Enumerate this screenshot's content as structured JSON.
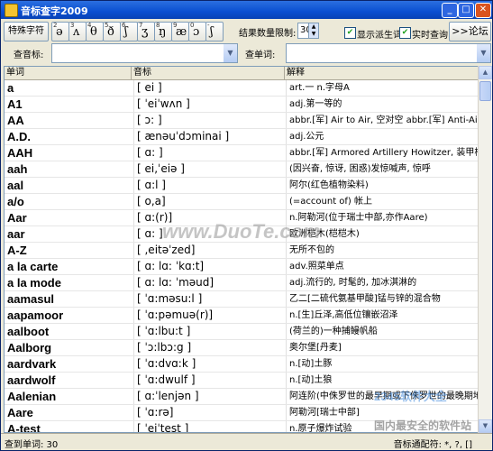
{
  "window": {
    "title": "音标查字2009"
  },
  "toolbar": {
    "special_chars_label": "特殊字符",
    "symbols": [
      {
        "n": "2",
        "g": "ə"
      },
      {
        "n": "3",
        "g": "ʌ"
      },
      {
        "n": "4",
        "g": "θ"
      },
      {
        "n": "5",
        "g": "ð"
      },
      {
        "n": "6",
        "g": "ʃ"
      },
      {
        "n": "7",
        "g": "ʒ"
      },
      {
        "n": "8",
        "g": "ŋ"
      },
      {
        "n": "9",
        "g": "æ"
      },
      {
        "n": "0",
        "g": "ɔ"
      },
      {
        "n": "-",
        "g": "ʃ"
      }
    ],
    "limit_label": "结果数量限制:",
    "limit_value": "30",
    "show_phonetic_label": "显示派生词",
    "show_phonetic_checked": true,
    "live_search_label": "实时查询",
    "live_search_checked": true,
    "forum_button": ">>论坛"
  },
  "search": {
    "phonetic_label": "查音标:",
    "phonetic_value": "",
    "word_label": "查单词:",
    "word_value": ""
  },
  "table": {
    "headers": [
      "单词",
      "音标",
      "解释"
    ],
    "rows": [
      {
        "word": "a",
        "phonetic": "[ ei ]",
        "def": "art.一 n.字母A"
      },
      {
        "word": "A1",
        "phonetic": "[ ˈeiˈwʌn ]",
        "def": "adj.第一等的"
      },
      {
        "word": "AA",
        "phonetic": "[ ɔ: ]",
        "def": "abbr.[军] Air to Air, 空对空 abbr.[军] Anti-Aircraft, 防空"
      },
      {
        "word": "A.D.",
        "phonetic": "[ ænəuˈdɔminai ]",
        "def": "adj.公元"
      },
      {
        "word": "AAH",
        "phonetic": "[ ɑ: ]",
        "def": "abbr.[军] Armored Artillery Howitzer, 装甲榴弹炮 ab"
      },
      {
        "word": "aah",
        "phonetic": "[ ei,ˈeiə ]",
        "def": "(因兴奋, 惊讶, 困惑)发惊喊声, 惊呼"
      },
      {
        "word": "aal",
        "phonetic": "[ ɑ:l ]",
        "def": "阿尔(红色植物染料)"
      },
      {
        "word": "a/o",
        "phonetic": "[ o,a]",
        "def": "(=account of) 帐上"
      },
      {
        "word": "Aar",
        "phonetic": "[ ɑ:(r)]",
        "def": "n.阿勒河(位于瑞士中部,亦作Aare)"
      },
      {
        "word": "aar",
        "phonetic": "[ ɑ: ]",
        "def": "欧洲桤木(桤桤木)"
      },
      {
        "word": "A-Z",
        "phonetic": "[ ,eitəˈzed]",
        "def": "无所不包的"
      },
      {
        "word": "a la carte",
        "phonetic": "[ ɑ: lɑ: ˈkɑ:t]",
        "def": "adv.照菜单点"
      },
      {
        "word": "a la mode",
        "phonetic": "[ ɑ: lɑ: ˈməud]",
        "def": "adj.流行的, 时髦的, 加冰淇淋的"
      },
      {
        "word": "aamasul",
        "phonetic": "[ ˈɑ:məsu:l ]",
        "def": "乙二[二硫代氨基甲酸]锰与锌的混合物"
      },
      {
        "word": "aapamoor",
        "phonetic": "[ ˈɑ:pəmuə(r)]",
        "def": "n.[生]丘泽,高低位镶嵌沼泽"
      },
      {
        "word": "aalboot",
        "phonetic": "[ ˈɑ:lbu:t ]",
        "def": "(荷兰的)一种捕鳗帆船"
      },
      {
        "word": "Aalborg",
        "phonetic": "[ ˈɔ:lbɔ:g ]",
        "def": "奥尔堡[丹麦]"
      },
      {
        "word": "aardvark",
        "phonetic": "[ ˈɑ:dvɑ:k ]",
        "def": "n.[动]土豚"
      },
      {
        "word": "aardwolf",
        "phonetic": "[ ˈɑ:dwulf ]",
        "def": "n.[动]土狼"
      },
      {
        "word": "Aalenian",
        "phonetic": "[ ɑ:ˈlenjən ]",
        "def": "阿连阶(中侏罗世的最早期或下侏罗世的最晚期地层)"
      },
      {
        "word": "Aare",
        "phonetic": "[ ˈɑ:rə]",
        "def": "阿勒河[瑞士中部]"
      },
      {
        "word": "A-test",
        "phonetic": "[ ˈeiˈtest ]",
        "def": "n.原子爆炸试验"
      },
      {
        "word": "Aateck",
        "phonetic": "[ ˈætek ]",
        "def": "福代硫(杀菌剂)"
      }
    ]
  },
  "status": {
    "found_text": "查到单词: 30",
    "match_rule": "音标通配符: *, ?, []"
  },
  "watermarks": {
    "duote": "www.DuoTe.com",
    "site": "2345软件大全",
    "slogan": "国内最安全的软件站"
  }
}
